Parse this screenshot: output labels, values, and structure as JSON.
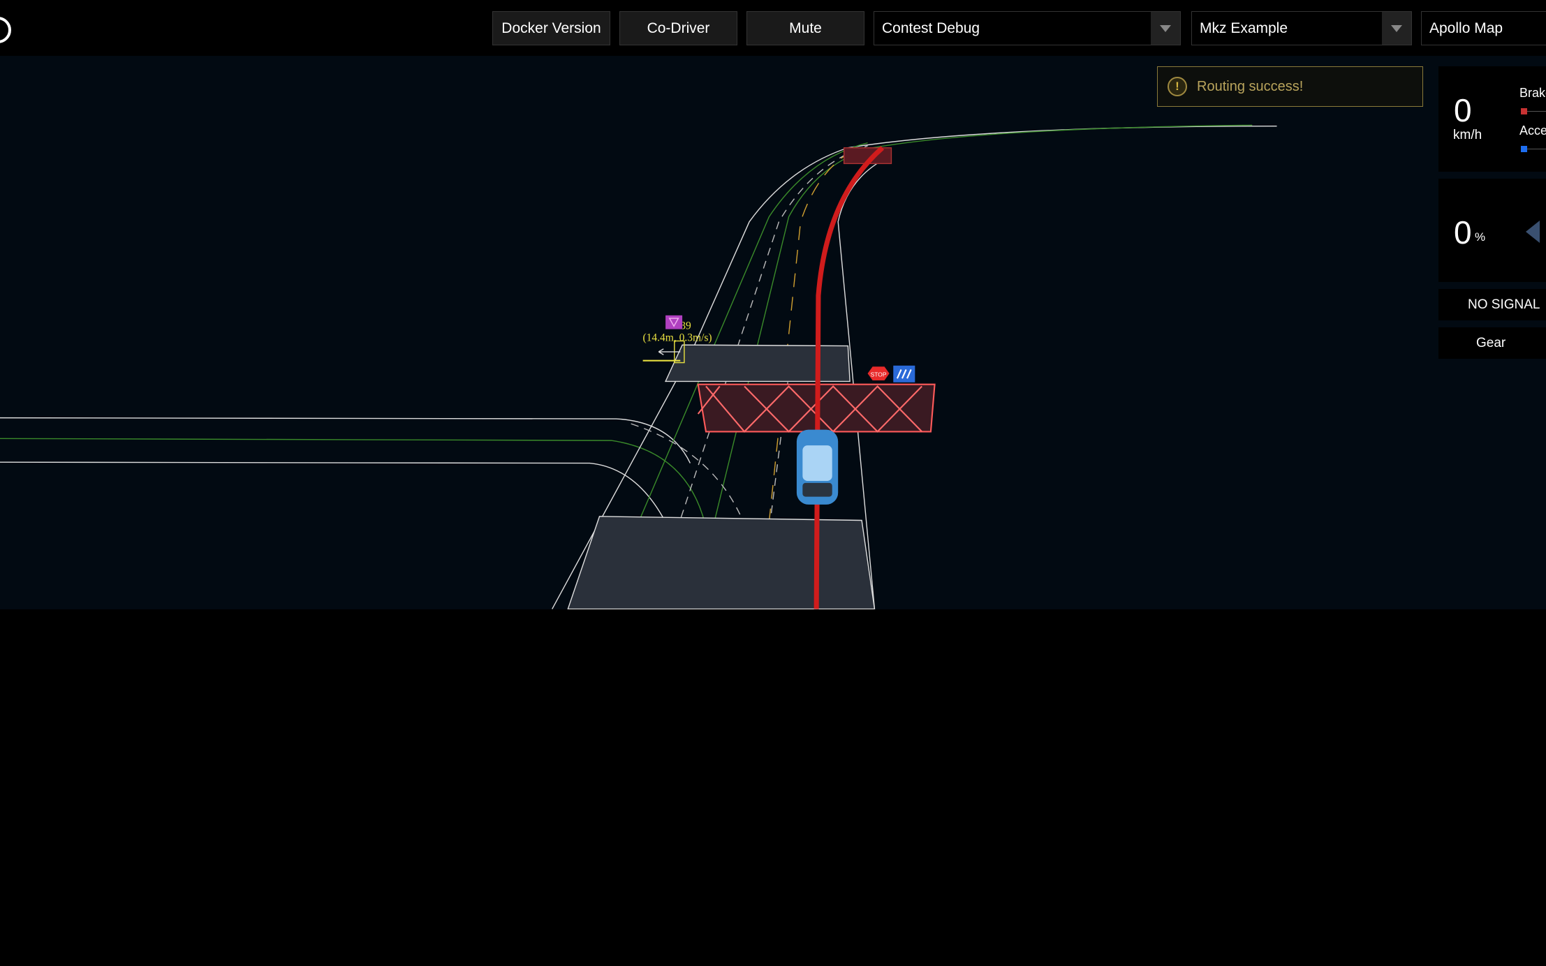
{
  "topbar": {
    "buttons": [
      "Docker Version",
      "Co-Driver",
      "Mute"
    ],
    "selects": [
      {
        "value": "Contest Debug"
      },
      {
        "value": "Mkz Example"
      },
      {
        "value": "Apollo Map"
      }
    ]
  },
  "notification": {
    "icon": "exclamation-circle-icon",
    "text": "Routing success!",
    "color": "#b9a45c"
  },
  "dashboard": {
    "speed": "0",
    "speed_unit": "km/h",
    "brake_label": "Brake",
    "accel_label": "Accelerator",
    "brake_color": "#c83232",
    "accel_color": "#1e6ef0",
    "steering": "0",
    "steering_unit": "%",
    "signal": "NO SIGNAL",
    "gear_label": "Gear"
  },
  "scene": {
    "obstacle_id": "6639",
    "obstacle_info": "(14.4m, 0.3m/s)",
    "stop_sign": "STOP",
    "planning_color": "#d01c1c",
    "stop_fence_color": "#ff5a5a"
  }
}
